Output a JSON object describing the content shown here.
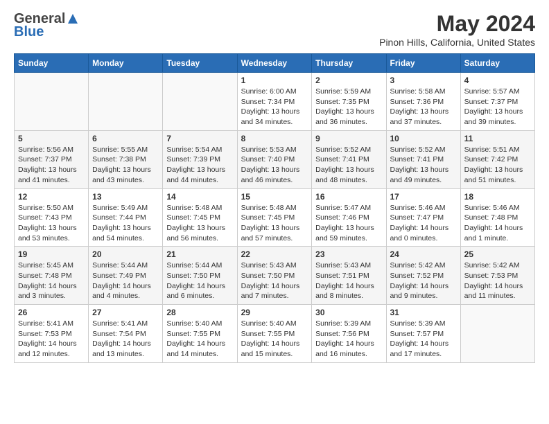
{
  "header": {
    "logo_general": "General",
    "logo_blue": "Blue",
    "month_title": "May 2024",
    "location": "Pinon Hills, California, United States"
  },
  "days_of_week": [
    "Sunday",
    "Monday",
    "Tuesday",
    "Wednesday",
    "Thursday",
    "Friday",
    "Saturday"
  ],
  "weeks": [
    [
      {
        "day": "",
        "info": ""
      },
      {
        "day": "",
        "info": ""
      },
      {
        "day": "",
        "info": ""
      },
      {
        "day": "1",
        "info": "Sunrise: 6:00 AM\nSunset: 7:34 PM\nDaylight: 13 hours\nand 34 minutes."
      },
      {
        "day": "2",
        "info": "Sunrise: 5:59 AM\nSunset: 7:35 PM\nDaylight: 13 hours\nand 36 minutes."
      },
      {
        "day": "3",
        "info": "Sunrise: 5:58 AM\nSunset: 7:36 PM\nDaylight: 13 hours\nand 37 minutes."
      },
      {
        "day": "4",
        "info": "Sunrise: 5:57 AM\nSunset: 7:37 PM\nDaylight: 13 hours\nand 39 minutes."
      }
    ],
    [
      {
        "day": "5",
        "info": "Sunrise: 5:56 AM\nSunset: 7:37 PM\nDaylight: 13 hours\nand 41 minutes."
      },
      {
        "day": "6",
        "info": "Sunrise: 5:55 AM\nSunset: 7:38 PM\nDaylight: 13 hours\nand 43 minutes."
      },
      {
        "day": "7",
        "info": "Sunrise: 5:54 AM\nSunset: 7:39 PM\nDaylight: 13 hours\nand 44 minutes."
      },
      {
        "day": "8",
        "info": "Sunrise: 5:53 AM\nSunset: 7:40 PM\nDaylight: 13 hours\nand 46 minutes."
      },
      {
        "day": "9",
        "info": "Sunrise: 5:52 AM\nSunset: 7:41 PM\nDaylight: 13 hours\nand 48 minutes."
      },
      {
        "day": "10",
        "info": "Sunrise: 5:52 AM\nSunset: 7:41 PM\nDaylight: 13 hours\nand 49 minutes."
      },
      {
        "day": "11",
        "info": "Sunrise: 5:51 AM\nSunset: 7:42 PM\nDaylight: 13 hours\nand 51 minutes."
      }
    ],
    [
      {
        "day": "12",
        "info": "Sunrise: 5:50 AM\nSunset: 7:43 PM\nDaylight: 13 hours\nand 53 minutes."
      },
      {
        "day": "13",
        "info": "Sunrise: 5:49 AM\nSunset: 7:44 PM\nDaylight: 13 hours\nand 54 minutes."
      },
      {
        "day": "14",
        "info": "Sunrise: 5:48 AM\nSunset: 7:45 PM\nDaylight: 13 hours\nand 56 minutes."
      },
      {
        "day": "15",
        "info": "Sunrise: 5:48 AM\nSunset: 7:45 PM\nDaylight: 13 hours\nand 57 minutes."
      },
      {
        "day": "16",
        "info": "Sunrise: 5:47 AM\nSunset: 7:46 PM\nDaylight: 13 hours\nand 59 minutes."
      },
      {
        "day": "17",
        "info": "Sunrise: 5:46 AM\nSunset: 7:47 PM\nDaylight: 14 hours\nand 0 minutes."
      },
      {
        "day": "18",
        "info": "Sunrise: 5:46 AM\nSunset: 7:48 PM\nDaylight: 14 hours\nand 1 minute."
      }
    ],
    [
      {
        "day": "19",
        "info": "Sunrise: 5:45 AM\nSunset: 7:48 PM\nDaylight: 14 hours\nand 3 minutes."
      },
      {
        "day": "20",
        "info": "Sunrise: 5:44 AM\nSunset: 7:49 PM\nDaylight: 14 hours\nand 4 minutes."
      },
      {
        "day": "21",
        "info": "Sunrise: 5:44 AM\nSunset: 7:50 PM\nDaylight: 14 hours\nand 6 minutes."
      },
      {
        "day": "22",
        "info": "Sunrise: 5:43 AM\nSunset: 7:50 PM\nDaylight: 14 hours\nand 7 minutes."
      },
      {
        "day": "23",
        "info": "Sunrise: 5:43 AM\nSunset: 7:51 PM\nDaylight: 14 hours\nand 8 minutes."
      },
      {
        "day": "24",
        "info": "Sunrise: 5:42 AM\nSunset: 7:52 PM\nDaylight: 14 hours\nand 9 minutes."
      },
      {
        "day": "25",
        "info": "Sunrise: 5:42 AM\nSunset: 7:53 PM\nDaylight: 14 hours\nand 11 minutes."
      }
    ],
    [
      {
        "day": "26",
        "info": "Sunrise: 5:41 AM\nSunset: 7:53 PM\nDaylight: 14 hours\nand 12 minutes."
      },
      {
        "day": "27",
        "info": "Sunrise: 5:41 AM\nSunset: 7:54 PM\nDaylight: 14 hours\nand 13 minutes."
      },
      {
        "day": "28",
        "info": "Sunrise: 5:40 AM\nSunset: 7:55 PM\nDaylight: 14 hours\nand 14 minutes."
      },
      {
        "day": "29",
        "info": "Sunrise: 5:40 AM\nSunset: 7:55 PM\nDaylight: 14 hours\nand 15 minutes."
      },
      {
        "day": "30",
        "info": "Sunrise: 5:39 AM\nSunset: 7:56 PM\nDaylight: 14 hours\nand 16 minutes."
      },
      {
        "day": "31",
        "info": "Sunrise: 5:39 AM\nSunset: 7:57 PM\nDaylight: 14 hours\nand 17 minutes."
      },
      {
        "day": "",
        "info": ""
      }
    ]
  ]
}
